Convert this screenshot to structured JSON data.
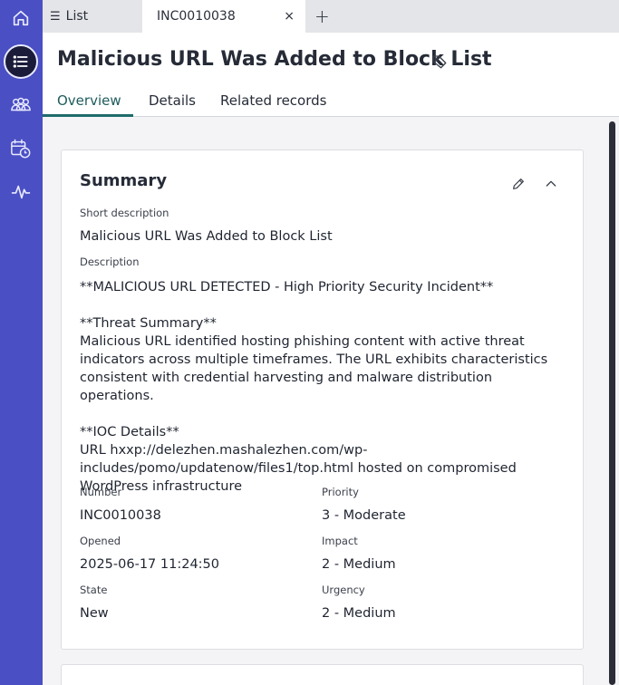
{
  "tabs": {
    "list_label": "List",
    "list_glyph": "☰",
    "incident_label": "INC0010038",
    "close_glyph": "×",
    "add_glyph": "+"
  },
  "rail": {
    "icons": [
      "home-icon",
      "list-icon",
      "groups-icon",
      "calendar-clock-icon",
      "activity-icon"
    ],
    "active": "list-icon"
  },
  "record": {
    "title": "Malicious URL Was Added to Block List",
    "subtabs": [
      "Overview",
      "Details",
      "Related records"
    ]
  },
  "summary": {
    "title": "Summary",
    "short_description_label": "Short description",
    "short_description": "Malicious URL Was Added to Block List",
    "description_label": "Description",
    "description": "**MALICIOUS URL DETECTED - High Priority Security Incident**\n\n**Threat Summary**\nMalicious URL identified hosting phishing content with active threat indicators across multiple timeframes. The URL exhibits characteristics consistent with credential harvesting and malware distribution operations.\n\n**IOC Details**\nURL hxxp://delezhen.mashalezhen.com/wp-includes/pomo/updatenow/files1/top.html hosted on compromised WordPress infrastructure",
    "number_label": "Number",
    "number": "INC0010038",
    "priority_label": "Priority",
    "priority": "3 - Moderate",
    "opened_label": "Opened",
    "opened": "2025-06-17 11:24:50",
    "impact_label": "Impact",
    "impact": "2 - Medium",
    "state_label": "State",
    "state": "New",
    "urgency_label": "Urgency",
    "urgency": "2 - Medium"
  },
  "colors": {
    "rail": "#4a4fc4",
    "active_tab_text": "#1f5c5c",
    "active_tab_underline": "#1f6b6b"
  }
}
